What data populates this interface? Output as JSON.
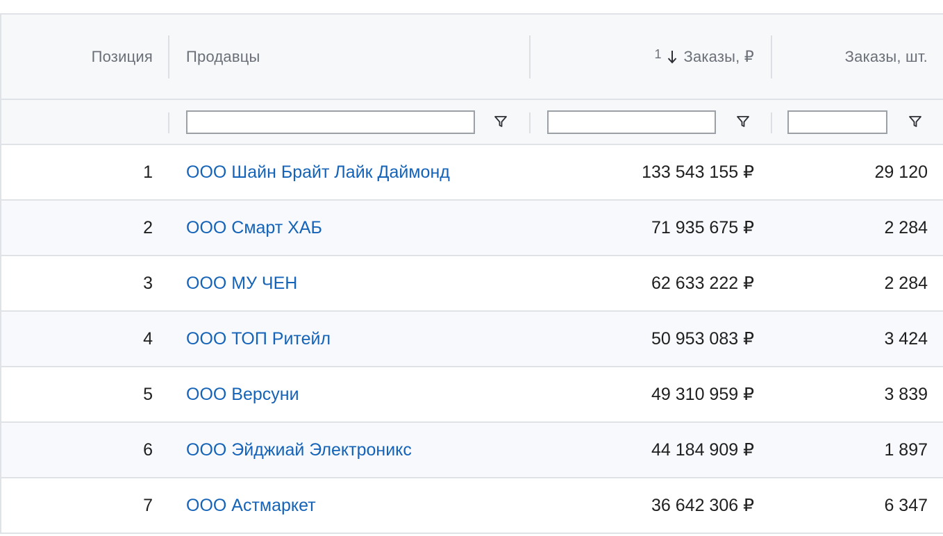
{
  "table": {
    "headers": {
      "position": "Позиция",
      "sellers": "Продавцы",
      "orders_rub": "Заказы, ₽",
      "orders_rub_sort_index": "1",
      "orders_pcs": "Заказы, шт."
    },
    "sort": {
      "column": "orders_rub",
      "direction": "descending",
      "icon": "arrow-down-icon"
    },
    "filters": {
      "sellers_value": "",
      "orders_rub_value": "",
      "orders_pcs_value": "",
      "icon": "filter-icon"
    },
    "rows": [
      {
        "position": "1",
        "seller": "ООО Шайн Брайт Лайк Даймонд",
        "orders_rub": "133 543 155 ₽",
        "orders_pcs": "29 120"
      },
      {
        "position": "2",
        "seller": "ООО Смарт ХАБ",
        "orders_rub": "71 935 675 ₽",
        "orders_pcs": "2 284"
      },
      {
        "position": "3",
        "seller": "ООО МУ ЧЕН",
        "orders_rub": "62 633 222 ₽",
        "orders_pcs": "2 284"
      },
      {
        "position": "4",
        "seller": "ООО ТОП Ритейл",
        "orders_rub": "50 953 083 ₽",
        "orders_pcs": "3 424"
      },
      {
        "position": "5",
        "seller": "ООО Версуни",
        "orders_rub": "49 310 959 ₽",
        "orders_pcs": "3 839"
      },
      {
        "position": "6",
        "seller": "ООО Эйджиай Электроникс",
        "orders_rub": "44 184 909 ₽",
        "orders_pcs": "1 897"
      },
      {
        "position": "7",
        "seller": "ООО Астмаркет",
        "orders_rub": "36 642 306 ₽",
        "orders_pcs": "6 347"
      }
    ]
  },
  "colors": {
    "link": "#1463b8",
    "header_bg": "#f7f8fa",
    "header_text": "#6b7078",
    "border": "#dfe2e6",
    "alt_row_bg": "#f7f9fc"
  }
}
